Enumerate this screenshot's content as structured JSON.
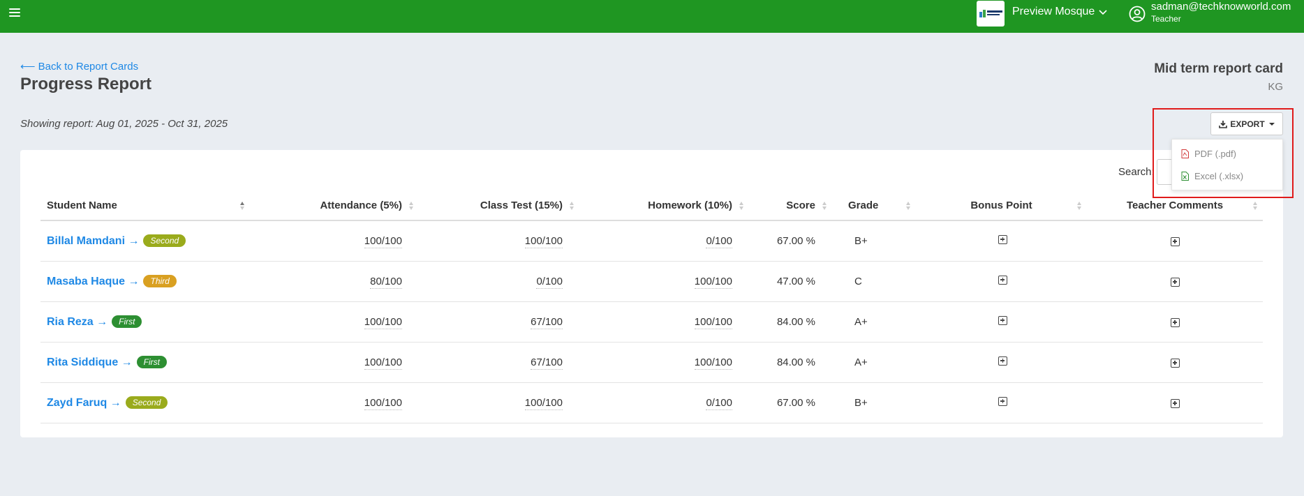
{
  "topbar": {
    "mosque_name": "Preview Mosque",
    "user_email": "sadman@techknowworld.com",
    "user_role": "Teacher",
    "brand_color": "#1f9622"
  },
  "header": {
    "back_label": "⟵ Back to Report Cards",
    "title": "Progress Report",
    "report_title": "Mid term report card",
    "report_class": "KG",
    "showing": "Showing report: Aug 01, 2025 - Oct 31, 2025"
  },
  "export": {
    "label": "EXPORT",
    "items": [
      {
        "label": "PDF (.pdf)",
        "icon": "pdf-file-icon"
      },
      {
        "label": "Excel (.xlsx)",
        "icon": "excel-file-icon"
      }
    ]
  },
  "search": {
    "label": "Search:"
  },
  "table": {
    "columns": [
      "Student Name",
      "Attendance (5%)",
      "Class Test (15%)",
      "Homework (10%)",
      "Score",
      "Grade",
      "Bonus Point",
      "Teacher Comments"
    ],
    "rows": [
      {
        "name": "Billal Mamdani →",
        "rank": "Second",
        "attendance": "100/100",
        "class_test": "100/100",
        "homework": "0/100",
        "score": "67.00 %",
        "grade": "B+"
      },
      {
        "name": "Masaba Haque →",
        "rank": "Third",
        "attendance": "80/100",
        "class_test": "0/100",
        "homework": "100/100",
        "score": "47.00 %",
        "grade": "C"
      },
      {
        "name": "Ria Reza →",
        "rank": "First",
        "attendance": "100/100",
        "class_test": "67/100",
        "homework": "100/100",
        "score": "84.00 %",
        "grade": "A+"
      },
      {
        "name": "Rita Siddique →",
        "rank": "First",
        "attendance": "100/100",
        "class_test": "67/100",
        "homework": "100/100",
        "score": "84.00 %",
        "grade": "A+"
      },
      {
        "name": "Zayd Faruq →",
        "rank": "Second",
        "attendance": "100/100",
        "class_test": "100/100",
        "homework": "0/100",
        "score": "67.00 %",
        "grade": "B+"
      }
    ]
  }
}
